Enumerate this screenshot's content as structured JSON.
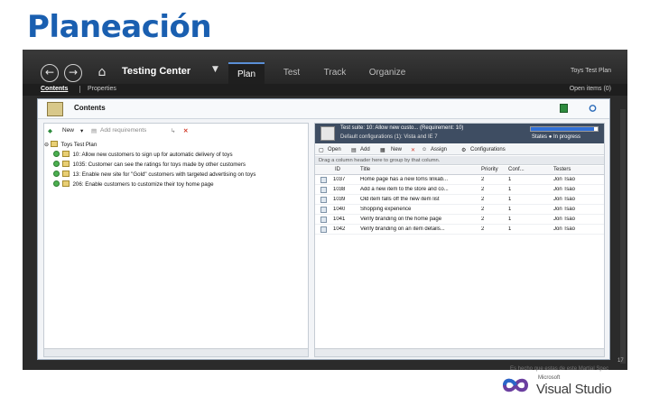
{
  "slide": {
    "title": "Planeación"
  },
  "app": {
    "title": "Testing Center",
    "tabs": [
      {
        "label": "Plan",
        "active": true
      },
      {
        "label": "Test",
        "active": false
      },
      {
        "label": "Track",
        "active": false
      },
      {
        "label": "Organize",
        "active": false
      }
    ],
    "top_right": "Toys Test Plan",
    "subnav": {
      "contents": "Contents",
      "separator": "|",
      "properties": "Properties",
      "right": "Open items (0)"
    }
  },
  "panel": {
    "title": "Contents",
    "left": {
      "toolbar": {
        "new": "New",
        "add_requirements": "Add requirements"
      },
      "tree": [
        "Toys Test Plan",
        "10: Allow new customers to sign up for automatic delivery of toys",
        "1035: Customer can see the ratings for toys made by other customers",
        "13: Enable new site for \"Gold\" customers with targeted advertising on toys",
        "206: Enable customers to customize their toy home page"
      ]
    },
    "right": {
      "header_line1": "Test suite: 10: Allow new custo... (Requirement: 10)",
      "header_line2": "Default configurations (1): Vista and IE 7",
      "progress": 0.95,
      "states_label": "States",
      "states_value": "In progress",
      "toolbar": {
        "open": "Open",
        "add": "Add",
        "new": "New",
        "assign": "Assign",
        "configurations": "Configurations"
      },
      "group_hint": "Drag a column header here to group by that column.",
      "columns": [
        "ID",
        "Title",
        "Priority",
        "Conf...",
        "Testers"
      ],
      "rows": [
        {
          "id": "1037",
          "title": "Home page has a new toms linkab...",
          "priority": "2",
          "conf": "1",
          "tester": "Jon Tsao"
        },
        {
          "id": "1038",
          "title": "Add a new item to the store and co...",
          "priority": "2",
          "conf": "1",
          "tester": "Jon Tsao"
        },
        {
          "id": "1039",
          "title": "Old item falls off the new item list",
          "priority": "2",
          "conf": "1",
          "tester": "Jon Tsao"
        },
        {
          "id": "1040",
          "title": "Shopping experience",
          "priority": "2",
          "conf": "1",
          "tester": "Jon Tsao"
        },
        {
          "id": "1041",
          "title": "Verify branding on the home page",
          "priority": "2",
          "conf": "1",
          "tester": "Jon Tsao"
        },
        {
          "id": "1042",
          "title": "Verify branding on an item details...",
          "priority": "2",
          "conf": "1",
          "tester": "Jon Tsao"
        }
      ]
    }
  },
  "footer": {
    "caption": "Es hecho que estas de este Martial Spec",
    "corner": "17"
  },
  "logo": {
    "microsoft": "Microsoft",
    "product": "Visual Studio"
  },
  "colors": {
    "title_blue": "#1a5fb0",
    "app_dark": "#2b2b2b",
    "accent": "#2f6fd6"
  }
}
